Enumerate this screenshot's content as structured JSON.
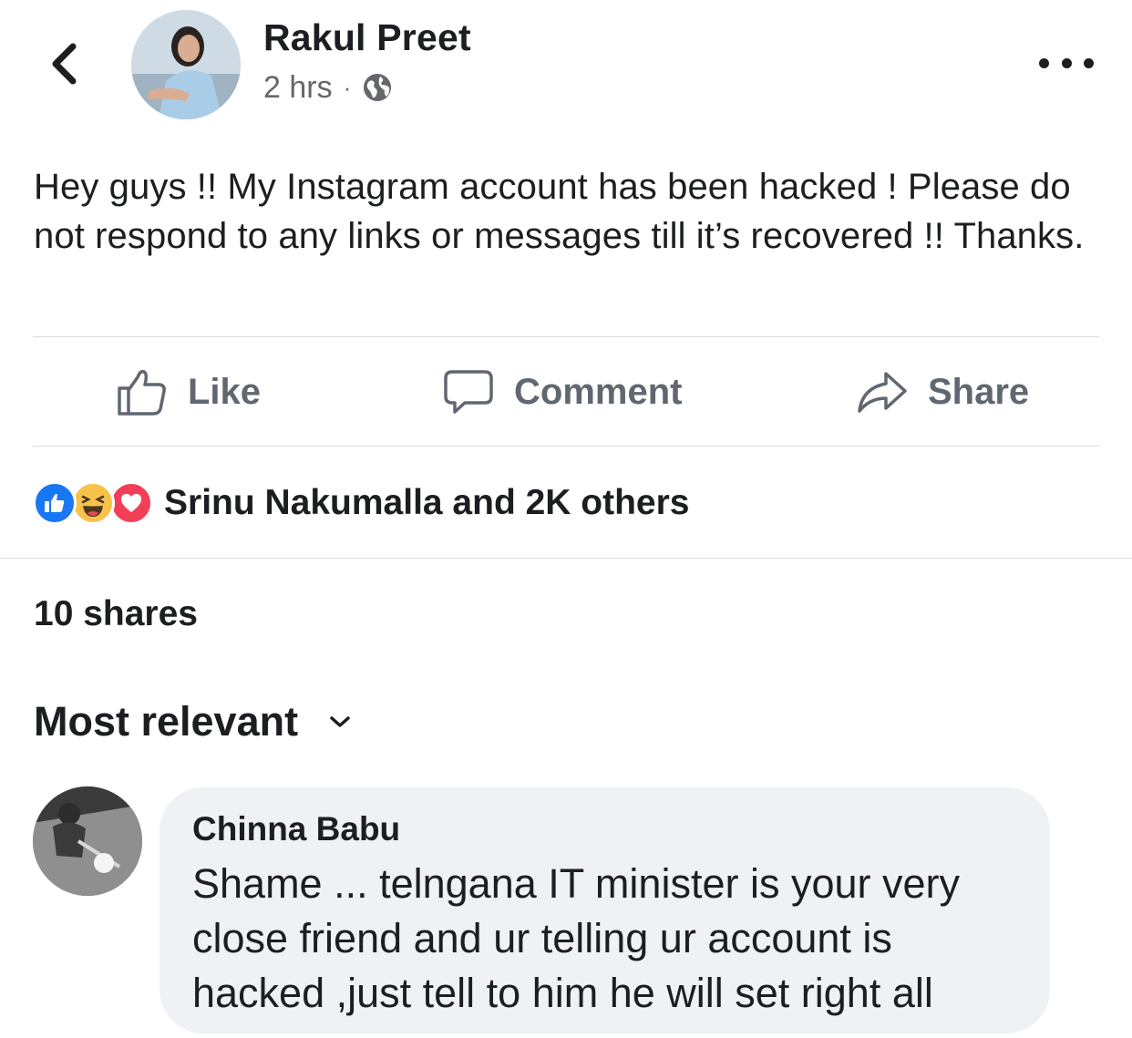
{
  "header": {
    "back_icon": "chevron-left-icon",
    "author": "Rakul Preet",
    "time": "2 hrs",
    "separator": "·",
    "privacy_icon": "globe-icon",
    "more_icon": "more-horizontal-icon"
  },
  "post": {
    "text": "Hey guys !! My Instagram account has been hacked ! Please do not respond to any links or messages till it’s recovered !! Thanks."
  },
  "actions": {
    "like_label": "Like",
    "comment_label": "Comment",
    "share_label": "Share"
  },
  "reactions": {
    "icons": [
      "like-reaction-icon",
      "haha-reaction-icon",
      "love-reaction-icon"
    ],
    "summary": "Srinu Nakumalla and 2K others"
  },
  "shares": {
    "count_label": "10 shares"
  },
  "comments": {
    "sort_label": "Most relevant",
    "items": [
      {
        "author": "Chinna Babu",
        "text": "Shame ... telngana IT minister is your very close friend and ur telling ur account is hacked ,just tell to him he will set right all"
      }
    ]
  },
  "colors": {
    "text_primary": "#1c1e21",
    "text_secondary": "#65676b",
    "action_gray": "#606770",
    "divider": "#dadde1",
    "bubble_bg": "#eff1f4",
    "like_blue": "#1877f2",
    "love_red": "#f33e58",
    "haha_yellow": "#f7c24a"
  }
}
